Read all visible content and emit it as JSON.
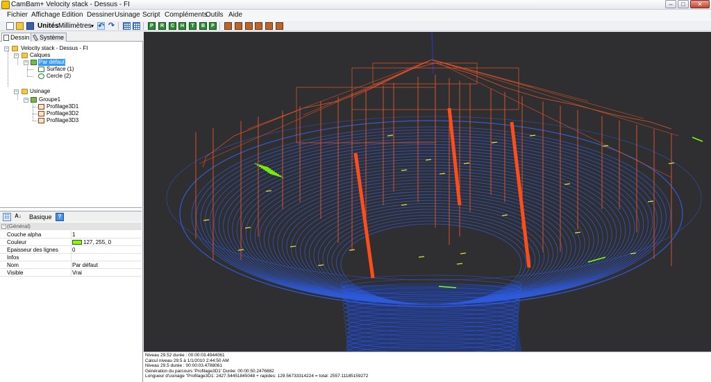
{
  "window": {
    "title": "CamBam+  Velocity stack - Dessus - FI",
    "controls": {
      "minimize": "–",
      "maximize": "□",
      "close": "✕"
    }
  },
  "menu": [
    "Fichier",
    "Affichage",
    "Edition",
    "Dessiner",
    "Usinage",
    "Script",
    "Compléments",
    "Outils",
    "Aide"
  ],
  "toolbar": {
    "units_label": "Unités",
    "units_value": "Millimètres",
    "dropdown_arrow": "▾",
    "undo": "↶",
    "redo": "↷",
    "green_tool_glyphs": [
      "P",
      "R",
      "C",
      "H",
      "T",
      "B",
      "P"
    ]
  },
  "tabs": {
    "dessin": "Dessin",
    "systeme": "Système"
  },
  "tree": {
    "root": "Velocity stack - Dessus - FI",
    "calques": "Calques",
    "par_defaut": "Par défaut",
    "surface": "Surface (1)",
    "cercle": "Cercle (2)",
    "usinage": "Usinage",
    "groupe1": "Groupe1",
    "op1": "Profilage3D1",
    "op2": "Profilage3D2",
    "op3": "Profilage3D3",
    "expand_minus": "−"
  },
  "property_bar": {
    "categorized_icon": "☷",
    "alpha_icon": "A↓",
    "label": "Basique",
    "help": "?"
  },
  "properties": {
    "category": "(Général)",
    "rows": [
      {
        "name": "Couche alpha",
        "value": "1"
      },
      {
        "name": "Couleur",
        "value": "127, 255, 0",
        "swatch": "#7fff00"
      },
      {
        "name": "Epaisseur des lignes",
        "value": "0"
      },
      {
        "name": "Infos",
        "value": ""
      },
      {
        "name": "Nom",
        "value": "Par défaut"
      },
      {
        "name": "Visible",
        "value": "Vrai"
      }
    ]
  },
  "colors": {
    "viewport_bg": "#2f2f31",
    "surface_blue": "#2f5bdc",
    "toolpath_orange": "#e8552a",
    "marker_yellow": "#e8e23a",
    "layer_green": "#7fff00"
  },
  "log": [
    "Niveau 29.52 durée : 00:00:03.4944061",
    "Calcul niveau 29.5 à 1/1/2010 2:44:50 AM",
    "Niveau 29.5 durée : 00:00:03.4788061",
    "Génération du parcours 'Profilage3D1'  Durée: 00:00:50.2476882",
    "Longueur d'usinage \"Profilage3D1: 2427.54451845048 + rapides: 129.56733314224 = total: 2557.11185159272"
  ]
}
